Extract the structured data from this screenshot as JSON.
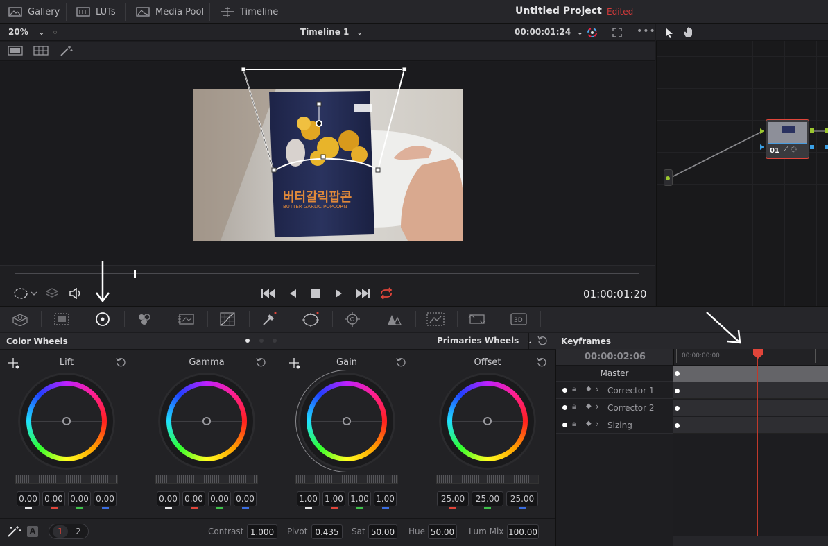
{
  "topbar": {
    "gallery": "Gallery",
    "luts": "LUTs",
    "media_pool": "Media Pool",
    "timeline": "Timeline",
    "project_title": "Untitled Project",
    "edited": "Edited"
  },
  "viewer": {
    "zoom": "20%",
    "timeline_name": "Timeline 1",
    "timecode_top": "00:00:01:24",
    "timecode_current": "01:00:01:20",
    "playhead_fraction": 0.19
  },
  "video_frame": {
    "brand_text": "버터갈릭팝콘",
    "brand_sub": "BUTTER GARLIC POPCORN"
  },
  "node": {
    "label": "01"
  },
  "color_wheels": {
    "title": "Color Wheels",
    "mode": "Primaries Wheels",
    "wheels": [
      {
        "name": "Lift",
        "values": [
          "0.00",
          "0.00",
          "0.00",
          "0.00"
        ]
      },
      {
        "name": "Gamma",
        "values": [
          "0.00",
          "0.00",
          "0.00",
          "0.00"
        ]
      },
      {
        "name": "Gain",
        "values": [
          "1.00",
          "1.00",
          "1.00",
          "1.00"
        ]
      },
      {
        "name": "Offset",
        "values": [
          "25.00",
          "25.00",
          "25.00"
        ]
      }
    ]
  },
  "bottom": {
    "page1": "1",
    "page2": "2",
    "auto": "A",
    "contrast_label": "Contrast",
    "contrast": "1.000",
    "pivot_label": "Pivot",
    "pivot": "0.435",
    "sat_label": "Sat",
    "sat": "50.00",
    "hue_label": "Hue",
    "hue": "50.00",
    "lummix_label": "Lum Mix",
    "lummix": "100.00"
  },
  "keyframes": {
    "title": "Keyframes",
    "timecode": "00:00:02:06",
    "ruler_start": "00:00:00:00",
    "rows": [
      "Master",
      "Corrector 1",
      "Corrector 2",
      "Sizing"
    ]
  },
  "colors": {
    "accent_red": "#d23a3a",
    "playhead": "#e0453a"
  }
}
